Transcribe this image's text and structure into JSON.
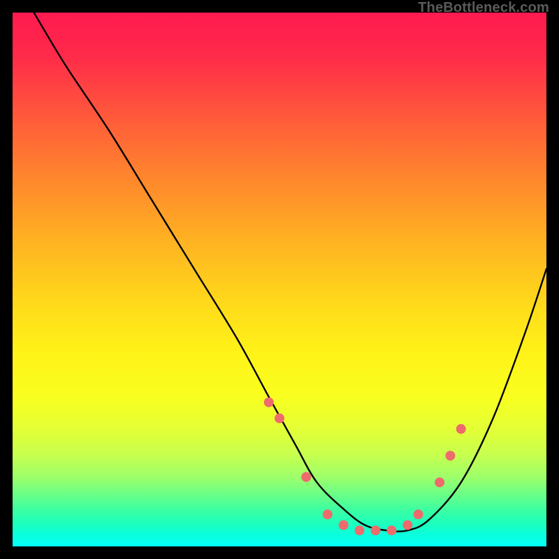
{
  "attribution": "TheBottleneck.com",
  "chart_data": {
    "type": "line",
    "title": "",
    "xlabel": "",
    "ylabel": "",
    "xlim": [
      0,
      100
    ],
    "ylim": [
      0,
      100
    ],
    "grid": false,
    "legend": false,
    "background_gradient": {
      "orientation": "vertical",
      "stops": [
        {
          "pos": 0,
          "color": "#ff1a50"
        },
        {
          "pos": 50,
          "color": "#ffd01b"
        },
        {
          "pos": 80,
          "color": "#e8ff2e"
        },
        {
          "pos": 100,
          "color": "#04fff8"
        }
      ]
    },
    "series": [
      {
        "name": "bottleneck-curve",
        "color": "#000000",
        "stroke_width": 2,
        "x": [
          4,
          10,
          18,
          26,
          34,
          42,
          48,
          53,
          57,
          62,
          66,
          70,
          74,
          78,
          84,
          90,
          96,
          100
        ],
        "y": [
          100,
          90,
          78,
          65,
          52,
          39,
          28,
          19,
          12,
          7,
          4,
          3,
          3,
          5,
          12,
          24,
          40,
          52
        ]
      }
    ],
    "markers": {
      "name": "highlight-points",
      "color": "#ed6b6c",
      "radius": 7,
      "points": [
        {
          "x": 48,
          "y": 27
        },
        {
          "x": 50,
          "y": 24
        },
        {
          "x": 55,
          "y": 13
        },
        {
          "x": 59,
          "y": 6
        },
        {
          "x": 62,
          "y": 4
        },
        {
          "x": 65,
          "y": 3
        },
        {
          "x": 68,
          "y": 3
        },
        {
          "x": 71,
          "y": 3
        },
        {
          "x": 74,
          "y": 4
        },
        {
          "x": 76,
          "y": 6
        },
        {
          "x": 80,
          "y": 12
        },
        {
          "x": 82,
          "y": 17
        },
        {
          "x": 84,
          "y": 22
        }
      ]
    }
  }
}
